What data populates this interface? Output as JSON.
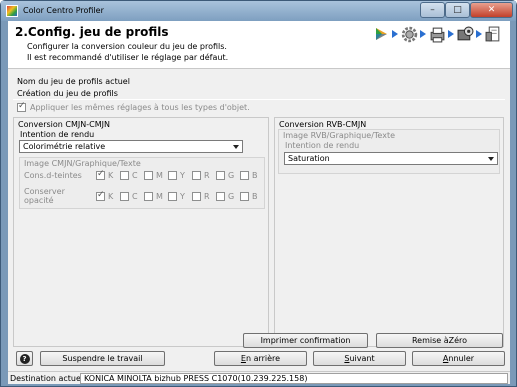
{
  "window": {
    "title": "Color Centro Profiler",
    "controls": {
      "minimize": "–",
      "maximize": "□",
      "close": "✕"
    }
  },
  "header": {
    "title": "2.Config. jeu de profils",
    "desc_line1": "Configurer la conversion couleur du jeu de profils.",
    "desc_line2": "Il est recommandé d'utiliser le réglage par défaut.",
    "steps": [
      "play-icon",
      "gear-icon",
      "printer-icon",
      "printer-gear-icon",
      "document-icon"
    ]
  },
  "info": {
    "profile_set_label": "Nom du jeu de profils actuel",
    "creation_label": "Création du jeu de profils"
  },
  "apply_all": {
    "label": "Appliquer les mêmes réglages à tous les types d'objet.",
    "checked": true
  },
  "cmyk": {
    "title": "Conversion CMJN-CMJN",
    "intent_label": "Intention de rendu",
    "intent_value": "Colorimétrie relative",
    "group_title": "Image CMJN/Graphique/Texte",
    "inks": [
      "K",
      "C",
      "M",
      "Y",
      "R",
      "G",
      "B"
    ],
    "rows": [
      {
        "label": "Cons.d-teintes",
        "checked": [
          true,
          false,
          false,
          false,
          false,
          false,
          false
        ]
      },
      {
        "label": "Conserver opacité",
        "checked": [
          true,
          false,
          false,
          false,
          false,
          false,
          false
        ]
      }
    ]
  },
  "rgb": {
    "title": "Conversion RVB-CMJN",
    "group_title": "Image RVB/Graphique/Texte",
    "intent_label": "Intention de rendu",
    "intent_value": "Saturation"
  },
  "buttons": {
    "print_confirm": "Imprimer confirmation",
    "reset": "Remise àZéro",
    "suspend": "Suspendre le travail",
    "back_prefix": "E",
    "back_rest": "n arrière",
    "next_prefix": "S",
    "next_rest": "uivant",
    "cancel_prefix": "A",
    "cancel_rest": "nnuler",
    "help": "?"
  },
  "status": {
    "label": "Destination actuelle",
    "value": "KONICA MINOLTA bizhub PRESS C1070(10.239.225.158)"
  },
  "colors": {
    "accent": "#2a6fd0",
    "titlebar": "#a9c3dc"
  }
}
